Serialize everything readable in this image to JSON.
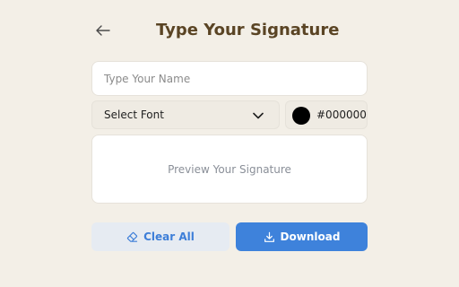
{
  "header": {
    "title": "Type Your Signature",
    "back_icon": "arrow-left-icon"
  },
  "name_input": {
    "placeholder": "Type Your Name",
    "value": ""
  },
  "font_select": {
    "selected": "Select Font",
    "icon": "chevron-down-icon"
  },
  "color_picker": {
    "value": "#000000",
    "swatch_color": "#000000"
  },
  "preview": {
    "placeholder": "Preview Your Signature"
  },
  "actions": {
    "clear_label": "Clear All",
    "clear_icon": "eraser-icon",
    "download_label": "Download",
    "download_icon": "download-icon"
  },
  "colors": {
    "background": "#f3efe7",
    "title": "#5a4424",
    "accent": "#3e82db",
    "clear_bg": "#e6ebf2"
  }
}
